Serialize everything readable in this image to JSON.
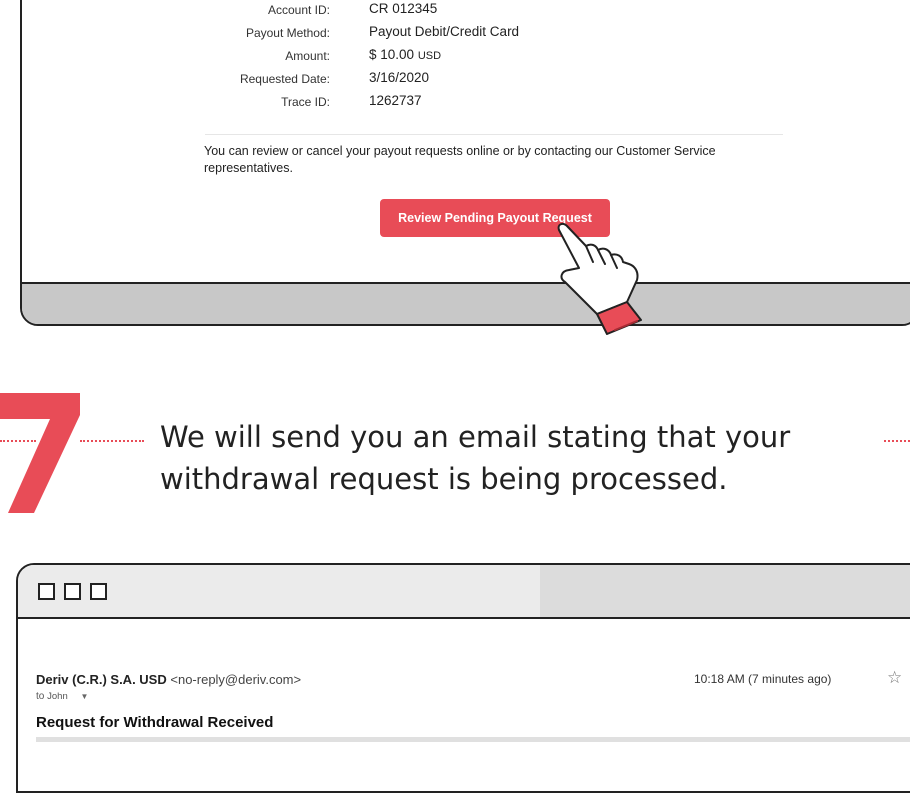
{
  "payout_details": {
    "rows": [
      {
        "label": "Account ID:",
        "value": "CR 012345",
        "unit": ""
      },
      {
        "label": "Payout Method:",
        "value": "Payout Debit/Credit Card",
        "unit": ""
      },
      {
        "label": "Amount:",
        "value": "$ 10.00",
        "unit": "USD"
      },
      {
        "label": "Requested Date:",
        "value": "3/16/2020",
        "unit": ""
      },
      {
        "label": "Trace ID:",
        "value": "1262737",
        "unit": ""
      }
    ],
    "note": "You can review or cancel your payout requests online or by contacting our Customer Service representatives.",
    "review_button": "Review Pending Payout Request"
  },
  "step": {
    "number": "7",
    "text": "We will send you an email stating that your withdrawal request is being processed."
  },
  "email": {
    "sender_name": "Deriv (C.R.) S.A. USD",
    "sender_email": "<no-reply@deriv.com>",
    "to_prefix": "to",
    "recipient": "John",
    "time": "10:18 AM (7 minutes ago)",
    "subject": "Request for Withdrawal Received"
  },
  "colors": {
    "accent": "#e84c57",
    "frame_gray": "#c8c8c8"
  }
}
